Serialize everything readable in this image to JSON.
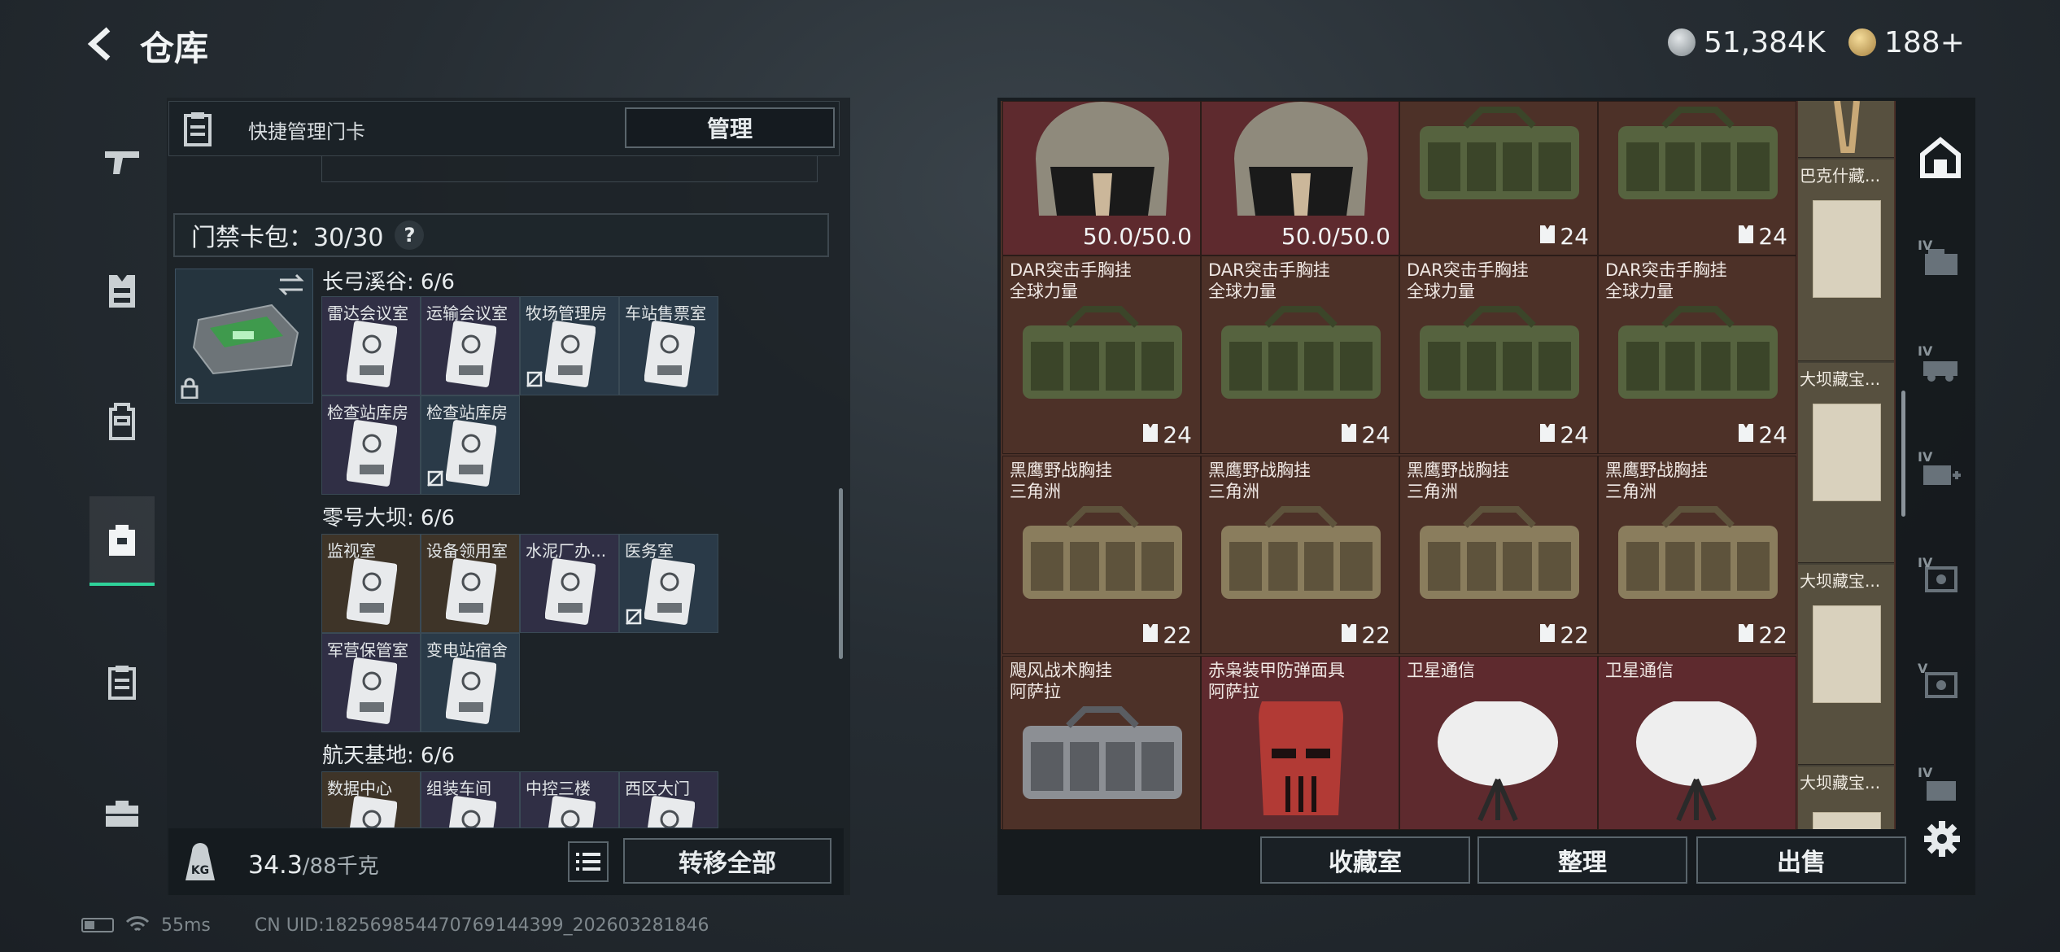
{
  "header": {
    "title": "仓库",
    "currency": [
      {
        "icon": "silver-coin-icon",
        "value": "51,384K",
        "color": "#9aa3a8"
      },
      {
        "icon": "gold-triangle-coin-icon",
        "value": "188+",
        "color": "#d2b36a"
      }
    ]
  },
  "left_rail": {
    "items": [
      {
        "icon": "weapon-icon"
      },
      {
        "icon": "armor-vest-icon"
      },
      {
        "icon": "backpack-icon"
      },
      {
        "icon": "warehouse-bag-icon",
        "active": true
      },
      {
        "icon": "clipboard-icon"
      },
      {
        "icon": "toolbox-icon"
      }
    ],
    "accent": "#2fd29a"
  },
  "quick_manage": {
    "label": "快捷管理门卡",
    "button": "管理"
  },
  "keycard_pack": {
    "label": "门禁卡包：30/30",
    "help": "?"
  },
  "groups": [
    {
      "title": "长弓溪谷: 6/6",
      "cards": [
        {
          "label": "雷达会议室",
          "rarity": "violet"
        },
        {
          "label": "运输会议室",
          "rarity": "violet"
        },
        {
          "label": "牧场管理房",
          "rarity": "blue",
          "no_sell": true
        },
        {
          "label": "车站售票室",
          "rarity": "blue"
        },
        {
          "label": "检查站库房",
          "rarity": "violet"
        },
        {
          "label": "检查站库房",
          "rarity": "blue",
          "no_sell": true
        }
      ]
    },
    {
      "title": "零号大坝: 6/6",
      "cards": [
        {
          "label": "监视室",
          "rarity": "gold"
        },
        {
          "label": "设备领用室",
          "rarity": "gold"
        },
        {
          "label": "水泥厂办...",
          "rarity": "violet"
        },
        {
          "label": "医务室",
          "rarity": "blue",
          "no_sell": true
        },
        {
          "label": "军营保管室",
          "rarity": "violet"
        },
        {
          "label": "变电站宿舍",
          "rarity": "blue"
        }
      ]
    },
    {
      "title": "航天基地: 6/6",
      "cards": [
        {
          "label": "数据中心",
          "rarity": "gold"
        },
        {
          "label": "组装车间",
          "rarity": "violet"
        },
        {
          "label": "中控三楼",
          "rarity": "violet"
        },
        {
          "label": "西区大门",
          "rarity": "violet"
        }
      ]
    }
  ],
  "weight": {
    "current": "34.3",
    "capacity": "/88千克",
    "icon_label": "KG"
  },
  "transfer_all": "转移全部",
  "status_bar": {
    "ping": "55ms",
    "uid": "CN UID:18256985447076914439​9_202603281846"
  },
  "items": [
    {
      "name": "",
      "count": "50.0/50.0",
      "kind": "helmet",
      "bg": "red"
    },
    {
      "name": "",
      "count": "50.0/50.0",
      "kind": "helmet",
      "bg": "red"
    },
    {
      "name": "",
      "count": "24",
      "kind": "rig-green",
      "bg": "brown",
      "armor_icon": true
    },
    {
      "name": "",
      "count": "24",
      "kind": "rig-green",
      "bg": "brown",
      "armor_icon": true
    },
    {
      "name": "DAR突击手胸挂\n全球力量",
      "count": "24",
      "kind": "rig-green",
      "bg": "brown",
      "armor_icon": true
    },
    {
      "name": "DAR突击手胸挂\n全球力量",
      "count": "24",
      "kind": "rig-green",
      "bg": "brown",
      "armor_icon": true
    },
    {
      "name": "DAR突击手胸挂\n全球力量",
      "count": "24",
      "kind": "rig-green",
      "bg": "brown",
      "armor_icon": true
    },
    {
      "name": "DAR突击手胸挂\n全球力量",
      "count": "24",
      "kind": "rig-green",
      "bg": "brown",
      "armor_icon": true
    },
    {
      "name": "黑鹰野战胸挂\n三角洲",
      "count": "22",
      "kind": "rig-tan",
      "bg": "brown",
      "armor_icon": true
    },
    {
      "name": "黑鹰野战胸挂\n三角洲",
      "count": "22",
      "kind": "rig-tan",
      "bg": "brown",
      "armor_icon": true
    },
    {
      "name": "黑鹰野战胸挂\n三角洲",
      "count": "22",
      "kind": "rig-tan",
      "bg": "brown",
      "armor_icon": true
    },
    {
      "name": "黑鹰野战胸挂\n三角洲",
      "count": "22",
      "kind": "rig-tan",
      "bg": "brown",
      "armor_icon": true
    },
    {
      "name": "飓风战术胸挂\n阿萨拉",
      "count": "",
      "kind": "rig-grey",
      "bg": "brown"
    },
    {
      "name": "赤枭装甲防弹面具\n阿萨拉",
      "count": "",
      "kind": "mask",
      "bg": "red"
    },
    {
      "name": "卫星通信",
      "count": "",
      "kind": "dish",
      "bg": "red"
    },
    {
      "name": "卫星通信",
      "count": "",
      "kind": "dish",
      "bg": "red"
    }
  ],
  "side_items": [
    {
      "name": "",
      "kind": "strap"
    },
    {
      "name": "巴克什藏...",
      "kind": "map"
    },
    {
      "name": "大坝藏宝...",
      "kind": "map"
    },
    {
      "name": "大坝藏宝...",
      "kind": "map"
    },
    {
      "name": "大坝藏宝...",
      "kind": "map"
    }
  ],
  "actions": {
    "collection": "收藏室",
    "sort": "整理",
    "sell": "出售"
  },
  "right_rail": {
    "items": [
      {
        "icon": "stash-home-icon",
        "tier": ""
      },
      {
        "icon": "container-tier-4-icon",
        "tier": "IV"
      },
      {
        "icon": "container-truck-tier-4-icon",
        "tier": "IV"
      },
      {
        "icon": "container-add-tier-4-icon",
        "tier": "IV"
      },
      {
        "icon": "safe-tier-4-icon",
        "tier": "IV"
      },
      {
        "icon": "safe-tier-5-icon",
        "tier": "V"
      },
      {
        "icon": "container-tier-4-extra-icon",
        "tier": "IV"
      }
    ]
  }
}
